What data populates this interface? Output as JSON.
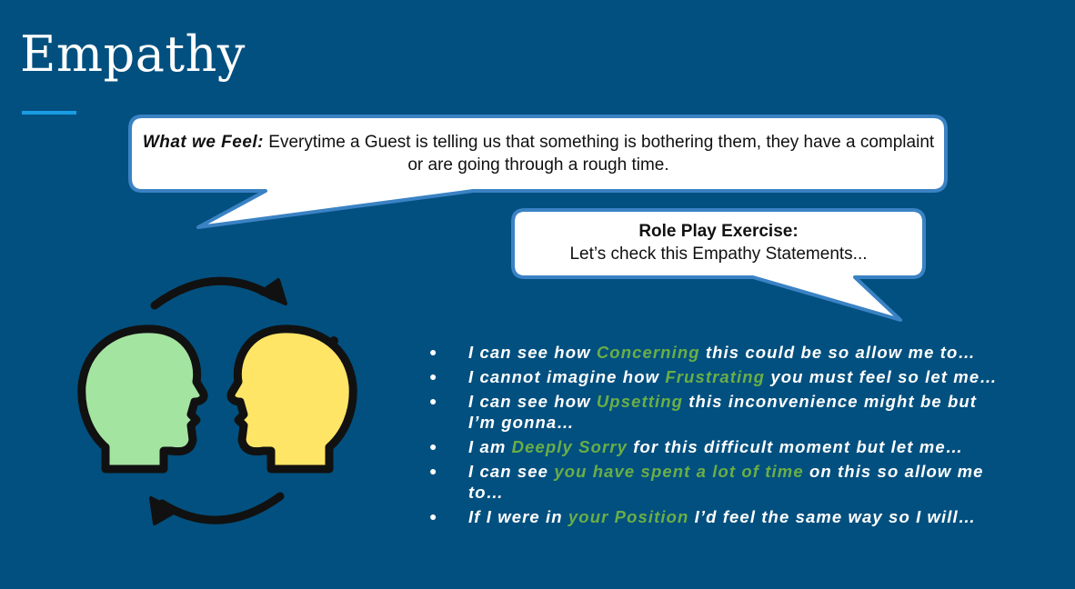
{
  "slide": {
    "title": "Empathy"
  },
  "feel_bubble": {
    "lead": "What we Feel:",
    "text": " Everytime a Guest is telling us that something is bothering them, they have a complaint or are going through a rough time."
  },
  "roleplay_bubble": {
    "heading": "Role Play Exercise:",
    "text": "Let’s check this Empathy Statements..."
  },
  "illustration": {
    "left_head_color": "#a3e4a1",
    "right_head_color": "#ffe566",
    "outline_color": "#111111"
  },
  "colors": {
    "background": "#02507f",
    "accent_bar": "#1a9ce5",
    "highlight": "#6aae47",
    "bubble_border": "#3a82c4"
  },
  "statements": [
    {
      "pre": "I can see how ",
      "hl": "Concerning",
      "post": " this could be so allow me to…"
    },
    {
      "pre": "I cannot imagine how ",
      "hl": "Frustrating",
      "post": " you must feel so let me…"
    },
    {
      "pre": "I can see how ",
      "hl": "Upsetting",
      "post": " this inconvenience might be but I’m gonna…"
    },
    {
      "pre": "I am ",
      "hl": "Deeply Sorry",
      "post": " for this difficult moment but let me…"
    },
    {
      "pre": "I can see ",
      "hl": "you have spent a lot of time",
      "post": " on this so allow me to…"
    },
    {
      "pre": "If I were in ",
      "hl": "your Position",
      "post": " I’d feel the same way so I will…"
    }
  ],
  "bullet_glyph": "●"
}
